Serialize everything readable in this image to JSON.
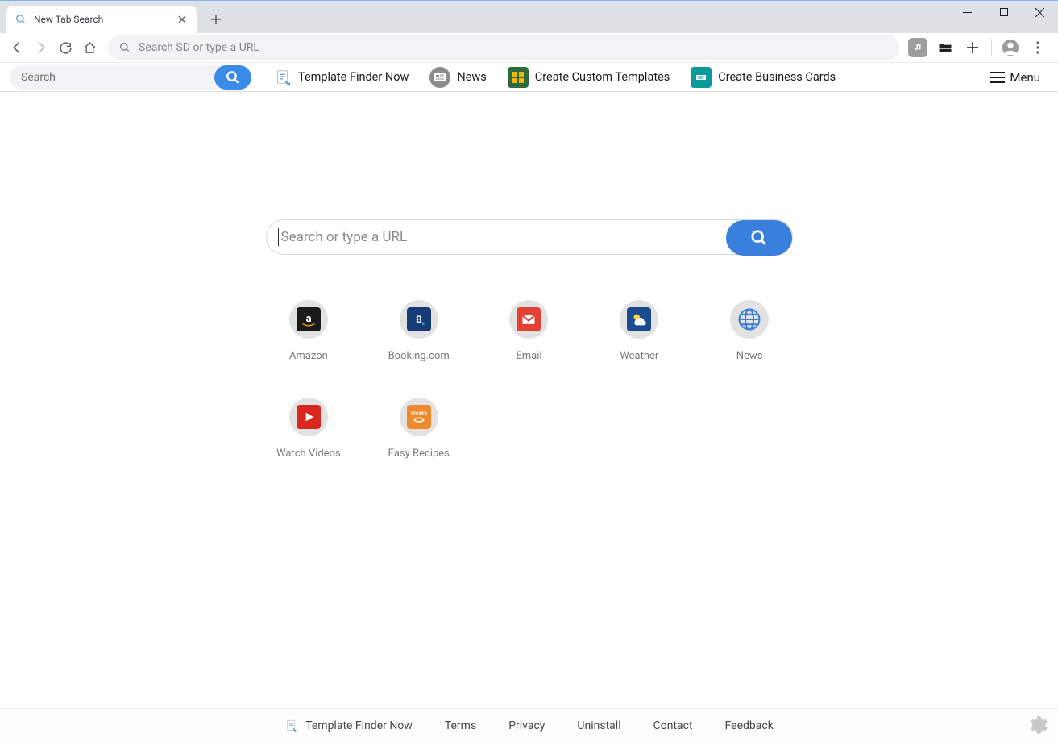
{
  "browser": {
    "tab_title": "New Tab Search",
    "omnibox_placeholder": "Search SD or type a URL"
  },
  "toolbar": {
    "search_placeholder": "Search",
    "links": [
      {
        "label": "Template Finder Now"
      },
      {
        "label": "News"
      },
      {
        "label": "Create Custom Templates"
      },
      {
        "label": "Create Business Cards"
      }
    ],
    "menu_label": "Menu"
  },
  "main": {
    "search_placeholder": "Search or type a URL",
    "shortcuts": [
      {
        "label": "Amazon"
      },
      {
        "label": "Booking.com"
      },
      {
        "label": "Email"
      },
      {
        "label": "Weather"
      },
      {
        "label": "News"
      },
      {
        "label": "Watch Videos"
      },
      {
        "label": "Easy Recipes"
      }
    ]
  },
  "footer": {
    "links": [
      {
        "label": "Template Finder Now"
      },
      {
        "label": "Terms"
      },
      {
        "label": "Privacy"
      },
      {
        "label": "Uninstall"
      },
      {
        "label": "Contact"
      },
      {
        "label": "Feedback"
      }
    ]
  }
}
